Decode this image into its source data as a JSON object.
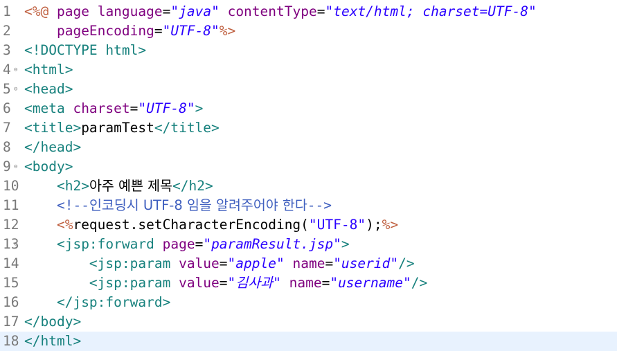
{
  "editor": {
    "current_line": 18,
    "lines": [
      {
        "num": "1",
        "fold": false,
        "segments": [
          {
            "t": "jsp",
            "v": "<%@"
          },
          {
            "t": "txt",
            "v": " "
          },
          {
            "t": "attr",
            "v": "page"
          },
          {
            "t": "txt",
            "v": " "
          },
          {
            "t": "attr",
            "v": "language"
          },
          {
            "t": "txt",
            "v": "="
          },
          {
            "t": "str",
            "v": "\"java\""
          },
          {
            "t": "txt",
            "v": " "
          },
          {
            "t": "attr",
            "v": "contentType"
          },
          {
            "t": "txt",
            "v": "="
          },
          {
            "t": "str",
            "v": "\"text/html; charset=UTF-8\""
          }
        ]
      },
      {
        "num": "2",
        "fold": false,
        "segments": [
          {
            "t": "txt",
            "v": "    "
          },
          {
            "t": "attr",
            "v": "pageEncoding"
          },
          {
            "t": "txt",
            "v": "="
          },
          {
            "t": "str",
            "v": "\"UTF-8\""
          },
          {
            "t": "jsp",
            "v": "%>"
          }
        ]
      },
      {
        "num": "3",
        "fold": false,
        "segments": [
          {
            "t": "tag",
            "v": "<!DOCTYPE html>"
          }
        ]
      },
      {
        "num": "4",
        "fold": true,
        "segments": [
          {
            "t": "tag",
            "v": "<html>"
          }
        ]
      },
      {
        "num": "5",
        "fold": true,
        "segments": [
          {
            "t": "tag",
            "v": "<head>"
          }
        ]
      },
      {
        "num": "6",
        "fold": false,
        "segments": [
          {
            "t": "tag",
            "v": "<meta"
          },
          {
            "t": "txt",
            "v": " "
          },
          {
            "t": "attr",
            "v": "charset"
          },
          {
            "t": "txt",
            "v": "="
          },
          {
            "t": "str",
            "v": "\"UTF-8\""
          },
          {
            "t": "tag",
            "v": ">"
          }
        ]
      },
      {
        "num": "7",
        "fold": false,
        "segments": [
          {
            "t": "tag",
            "v": "<title>"
          },
          {
            "t": "txt",
            "v": "paramTest"
          },
          {
            "t": "tag",
            "v": "</title>"
          }
        ]
      },
      {
        "num": "8",
        "fold": false,
        "segments": [
          {
            "t": "tag",
            "v": "</head>"
          }
        ]
      },
      {
        "num": "9",
        "fold": true,
        "segments": [
          {
            "t": "tag",
            "v": "<body>"
          }
        ]
      },
      {
        "num": "10",
        "fold": false,
        "segments": [
          {
            "t": "txt",
            "v": "    "
          },
          {
            "t": "tag",
            "v": "<h2>"
          },
          {
            "t": "ko",
            "v": "아주 예쁜 제목"
          },
          {
            "t": "tag",
            "v": "</h2>"
          }
        ]
      },
      {
        "num": "11",
        "fold": false,
        "segments": [
          {
            "t": "txt",
            "v": "    "
          },
          {
            "t": "cmt",
            "v": "<!--"
          },
          {
            "t": "cmtko",
            "v": "인코딩시 UTF-8 임을 알려주어야 한다"
          },
          {
            "t": "cmt",
            "v": "-->"
          }
        ]
      },
      {
        "num": "12",
        "fold": false,
        "segments": [
          {
            "t": "txt",
            "v": "    "
          },
          {
            "t": "jsp",
            "v": "<%"
          },
          {
            "t": "txt",
            "v": "request.setCharacterEncoding("
          },
          {
            "t": "jstr",
            "v": "\"UTF-8\""
          },
          {
            "t": "txt",
            "v": ");"
          },
          {
            "t": "jsp",
            "v": "%>"
          }
        ]
      },
      {
        "num": "13",
        "fold": true,
        "segments": [
          {
            "t": "txt",
            "v": "    "
          },
          {
            "t": "tag",
            "v": "<jsp:forward"
          },
          {
            "t": "txt",
            "v": " "
          },
          {
            "t": "attr",
            "v": "page"
          },
          {
            "t": "txt",
            "v": "="
          },
          {
            "t": "str",
            "v": "\"paramResult.jsp\""
          },
          {
            "t": "tag",
            "v": ">"
          }
        ]
      },
      {
        "num": "14",
        "fold": false,
        "segments": [
          {
            "t": "txt",
            "v": "        "
          },
          {
            "t": "tag",
            "v": "<jsp:param"
          },
          {
            "t": "txt",
            "v": " "
          },
          {
            "t": "attr",
            "v": "value"
          },
          {
            "t": "txt",
            "v": "="
          },
          {
            "t": "str",
            "v": "\"apple\""
          },
          {
            "t": "txt",
            "v": " "
          },
          {
            "t": "attr",
            "v": "name"
          },
          {
            "t": "txt",
            "v": "="
          },
          {
            "t": "str",
            "v": "\"userid\""
          },
          {
            "t": "tag",
            "v": "/>"
          }
        ]
      },
      {
        "num": "15",
        "fold": false,
        "segments": [
          {
            "t": "txt",
            "v": "        "
          },
          {
            "t": "tag",
            "v": "<jsp:param"
          },
          {
            "t": "txt",
            "v": " "
          },
          {
            "t": "attr",
            "v": "value"
          },
          {
            "t": "txt",
            "v": "="
          },
          {
            "t": "str",
            "v": "\""
          },
          {
            "t": "strko",
            "v": "김사과"
          },
          {
            "t": "str",
            "v": "\""
          },
          {
            "t": "txt",
            "v": " "
          },
          {
            "t": "attr",
            "v": "name"
          },
          {
            "t": "txt",
            "v": "="
          },
          {
            "t": "str",
            "v": "\"username\""
          },
          {
            "t": "tag",
            "v": "/>"
          }
        ]
      },
      {
        "num": "16",
        "fold": false,
        "segments": [
          {
            "t": "txt",
            "v": "    "
          },
          {
            "t": "tag",
            "v": "</jsp:forward>"
          }
        ]
      },
      {
        "num": "17",
        "fold": false,
        "segments": [
          {
            "t": "tag",
            "v": "</body>"
          }
        ]
      },
      {
        "num": "18",
        "fold": false,
        "segments": [
          {
            "t": "tag",
            "v": "</html>"
          }
        ]
      }
    ]
  }
}
